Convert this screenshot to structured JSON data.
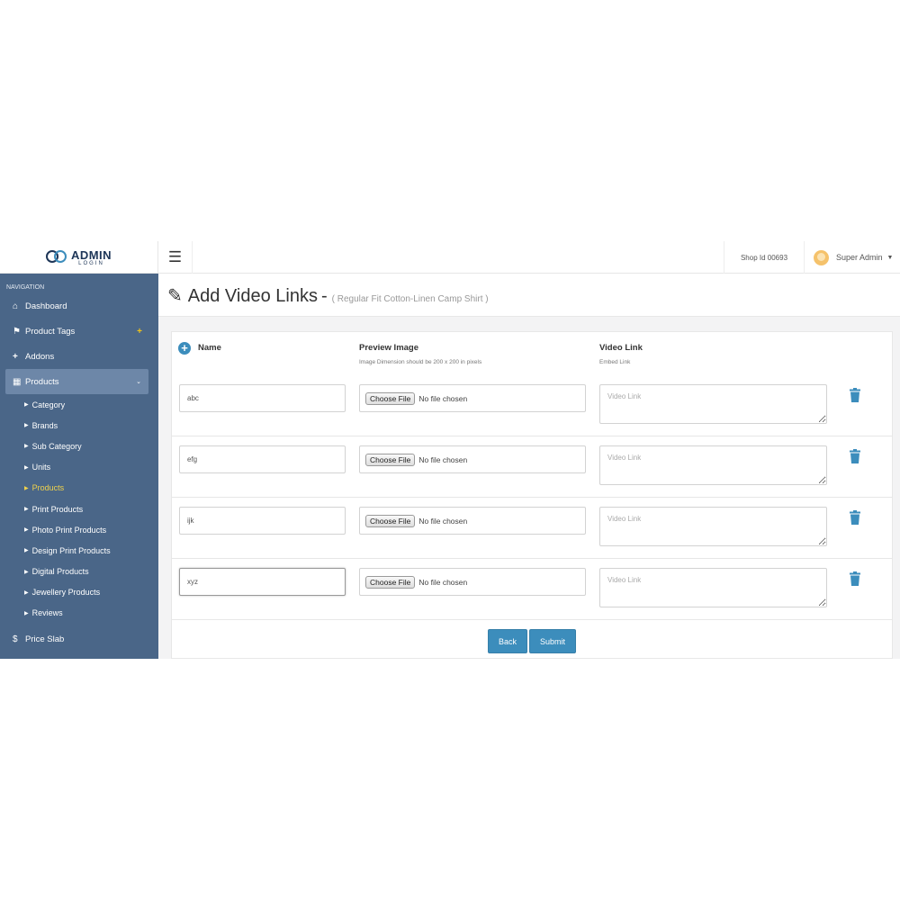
{
  "brand": {
    "title": "ADMIN",
    "subtitle": "LOGIN"
  },
  "header": {
    "shop_id": "Shop Id 00693",
    "user_name": "Super Admin"
  },
  "sidebar": {
    "heading": "NAVIGATION",
    "items": [
      {
        "label": "Dashboard"
      },
      {
        "label": "Product Tags"
      },
      {
        "label": "Addons"
      },
      {
        "label": "Products"
      }
    ],
    "sub_items": [
      {
        "label": "Category"
      },
      {
        "label": "Brands"
      },
      {
        "label": "Sub Category"
      },
      {
        "label": "Units"
      },
      {
        "label": "Products"
      },
      {
        "label": "Print Products"
      },
      {
        "label": "Photo Print Products"
      },
      {
        "label": "Design Print Products"
      },
      {
        "label": "Digital Products"
      },
      {
        "label": "Jewellery Products"
      },
      {
        "label": "Reviews"
      }
    ],
    "price_slab": {
      "label": "Price Slab"
    }
  },
  "page": {
    "title": "Add Video Links",
    "dash": "-",
    "product": "( Regular Fit Cotton-Linen Camp Shirt )"
  },
  "form": {
    "columns": {
      "name": "Name",
      "preview": "Preview Image",
      "preview_note": "Image Dimension should be 200 x 200 in pixels",
      "video": "Video Link",
      "video_note": "Embed Link"
    },
    "choose_file": "Choose File",
    "no_file": "No file chosen",
    "video_placeholder": "Video Link",
    "rows": [
      {
        "name": "abc"
      },
      {
        "name": "efg"
      },
      {
        "name": "ijk"
      },
      {
        "name": "xyz"
      }
    ],
    "back_label": "Back",
    "submit_label": "Submit"
  },
  "colors": {
    "sidebar_bg": "#4a6688",
    "accent": "#3c8dbc",
    "active_sub": "#f0d24b"
  }
}
